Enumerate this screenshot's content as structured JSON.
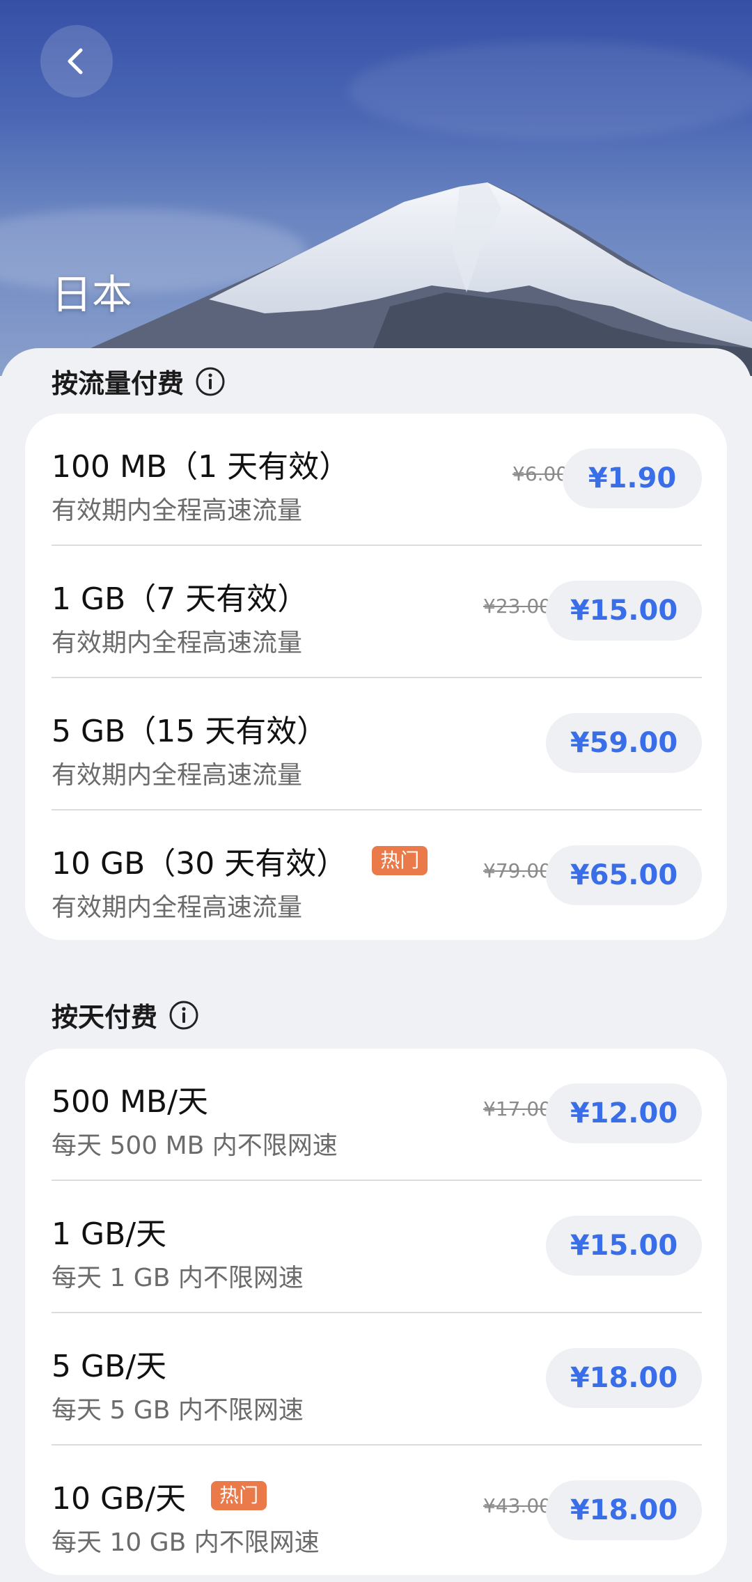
{
  "header": {
    "title": "日本"
  },
  "traffic_section": {
    "title": "按流量付费",
    "plans": [
      {
        "name": "100 MB（1 天有效）",
        "desc": "有效期内全程高速流量",
        "original_price": "¥6.00",
        "price": "¥1.90",
        "hot": ""
      },
      {
        "name": "1 GB（7 天有效）",
        "desc": "有效期内全程高速流量",
        "original_price": "¥23.00",
        "price": "¥15.00",
        "hot": ""
      },
      {
        "name": "5 GB（15 天有效）",
        "desc": "有效期内全程高速流量",
        "original_price": "",
        "price": "¥59.00",
        "hot": ""
      },
      {
        "name": "10 GB（30 天有效）",
        "desc": "有效期内全程高速流量",
        "original_price": "¥79.00",
        "price": "¥65.00",
        "hot": "热门"
      }
    ]
  },
  "daily_section": {
    "title": "按天付费",
    "plans": [
      {
        "name": "500 MB/天",
        "desc": "每天 500 MB 内不限网速",
        "original_price": "¥17.00",
        "price": "¥12.00",
        "hot": ""
      },
      {
        "name": "1 GB/天",
        "desc": "每天 1 GB 内不限网速",
        "original_price": "",
        "price": "¥15.00",
        "hot": ""
      },
      {
        "name": "5 GB/天",
        "desc": "每天 5 GB 内不限网速",
        "original_price": "",
        "price": "¥18.00",
        "hot": ""
      },
      {
        "name": "10 GB/天",
        "desc": "每天 10 GB 内不限网速",
        "original_price": "¥43.00",
        "price": "¥18.00",
        "hot": "热门"
      }
    ]
  },
  "colors": {
    "price_text": "#3a6ee8",
    "hot_badge": "#ea7a4a",
    "background": "#f0f1f5"
  },
  "icons": {
    "back": "chevron-left-icon",
    "info": "info-icon"
  }
}
